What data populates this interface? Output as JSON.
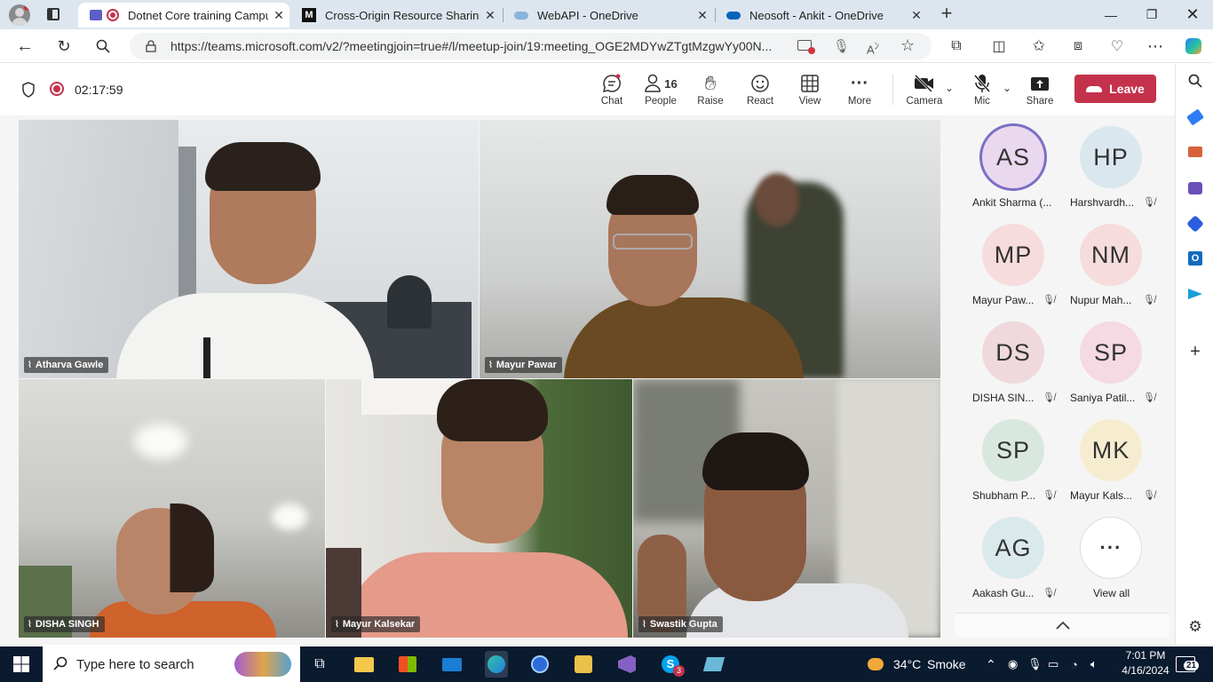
{
  "browser": {
    "tabs": [
      {
        "title": "Dotnet Core training Campu",
        "active": true
      },
      {
        "title": "Cross-Origin Resource Sharing (C",
        "active": false
      },
      {
        "title": "WebAPI - OneDrive",
        "active": false
      },
      {
        "title": "Neosoft - Ankit - OneDrive",
        "active": false
      }
    ],
    "url": "https://teams.microsoft.com/v2/?meetingjoin=true#/l/meetup-join/19:meeting_OGE2MDYwZTgtMzgwYy00N..."
  },
  "meeting": {
    "timer": "02:17:59",
    "toolbar": {
      "chat": "Chat",
      "people_count": "16",
      "people": "People",
      "raise": "Raise",
      "react": "React",
      "view": "View",
      "more": "More",
      "camera": "Camera",
      "mic": "Mic",
      "share": "Share",
      "leave": "Leave"
    },
    "video_tiles": [
      {
        "name": "Atharva Gawle"
      },
      {
        "name": "Mayur Pawar"
      },
      {
        "name": "DISHA SINGH"
      },
      {
        "name": "Mayur Kalsekar"
      },
      {
        "name": "Swastik Gupta"
      }
    ],
    "roster": [
      {
        "initials": "AS",
        "name": "Ankit Sharma (...",
        "muted": false,
        "color": "#ead9ee"
      },
      {
        "initials": "HP",
        "name": "Harshvardh...",
        "muted": true,
        "color": "#dbe7ef"
      },
      {
        "initials": "MP",
        "name": "Mayur Paw...",
        "muted": true,
        "color": "#f6dcdc"
      },
      {
        "initials": "NM",
        "name": "Nupur Mah...",
        "muted": true,
        "color": "#f6dcdc"
      },
      {
        "initials": "DS",
        "name": "DISHA SIN...",
        "muted": true,
        "color": "#f0d9dc"
      },
      {
        "initials": "SP",
        "name": "Saniya Patil...",
        "muted": true,
        "color": "#f5d9e3"
      },
      {
        "initials": "SP",
        "name": "Shubham P...",
        "muted": true,
        "color": "#d9e8df"
      },
      {
        "initials": "MK",
        "name": "Mayur Kals...",
        "muted": true,
        "color": "#f6ecd0"
      },
      {
        "initials": "AG",
        "name": "Aakash Gu...",
        "muted": true,
        "color": "#dae9ec"
      }
    ],
    "view_all": "View all"
  },
  "taskbar": {
    "search_placeholder": "Type here to search",
    "weather_temp": "34°C",
    "weather_text": "Smoke",
    "time": "7:01 PM",
    "date": "4/16/2024",
    "notifications": "21",
    "skype_badge": "3"
  }
}
